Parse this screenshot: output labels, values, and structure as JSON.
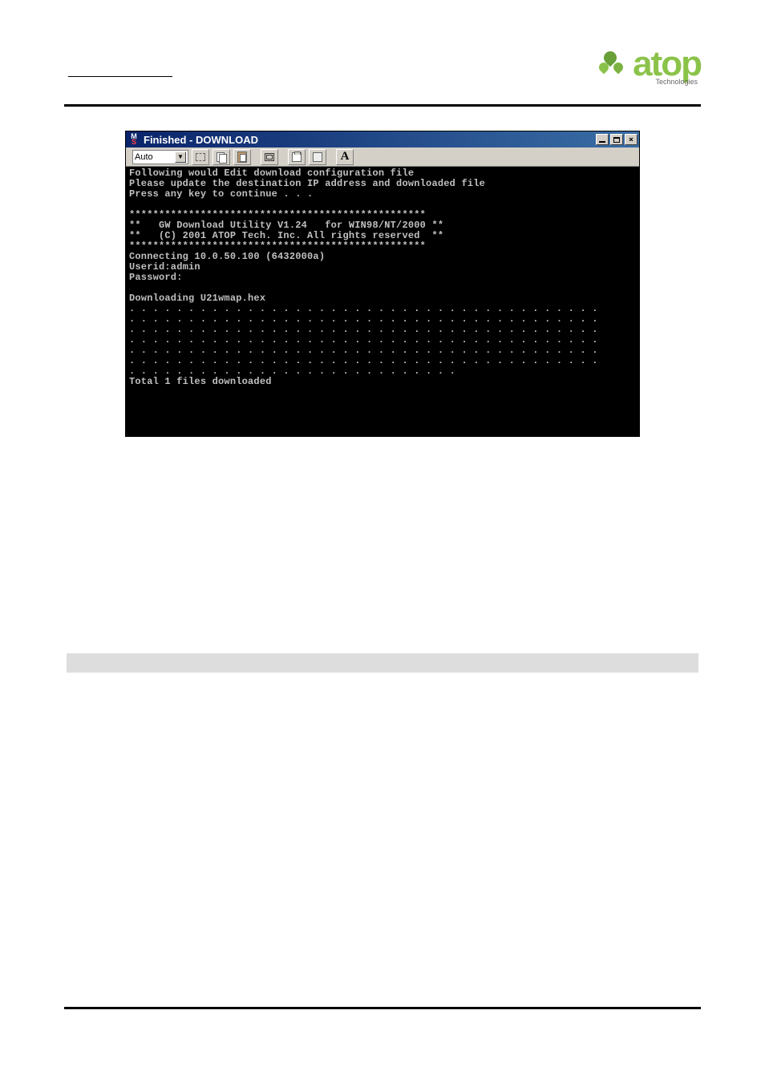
{
  "window": {
    "title": "Finished - DOWNLOAD",
    "icon_top": "M",
    "icon_bottom": "S"
  },
  "toolbar": {
    "select_value": "Auto",
    "font_btn": "A"
  },
  "console": {
    "line1": "Following would Edit download configuration file",
    "line2": "Please update the destination IP address and downloaded file",
    "line3": "Press any key to continue . . .",
    "line4": "",
    "line5": "**************************************************",
    "line6": "**   GW Download Utility V1.24   for WIN98/NT/2000 **",
    "line7": "**   (C) 2001 ATOP Tech. Inc. All rights reserved  **",
    "line8": "**************************************************",
    "line9": "Connecting 10.0.50.100 (6432000a)",
    "line10": "Userid:admin",
    "line11": "Password:",
    "line12": "",
    "line13": "Downloading U21wmap.hex",
    "line14": ". . . . . . . . . . . . . . . . . . . . . . . . . . . . . . . . . . . . . . . .",
    "line15": ". . . . . . . . . . . . . . . . . . . . . . . . . . . . . . . . . . . . . . . .",
    "line16": ". . . . . . . . . . . . . . . . . . . . . . . . . . . . . . . . . . . . . . . .",
    "line17": ". . . . . . . . . . . . . . . . . . . . . . . . . . . . . . . . . . . . . . . .",
    "line18": ". . . . . . . . . . . . . . . . . . . . . . . . . . . . . . . . . . . . . . . .",
    "line19": ". . . . . . . . . . . . . . . . . . . . . . . . . . . . . . . . . . . . . . . .",
    "line20": ". . . . . . . . . . . . . . . . . . . . . . . . . . . .",
    "line21": "Total 1 files downloaded"
  },
  "logo": {
    "text": "atop",
    "subtext": "Technologies"
  }
}
